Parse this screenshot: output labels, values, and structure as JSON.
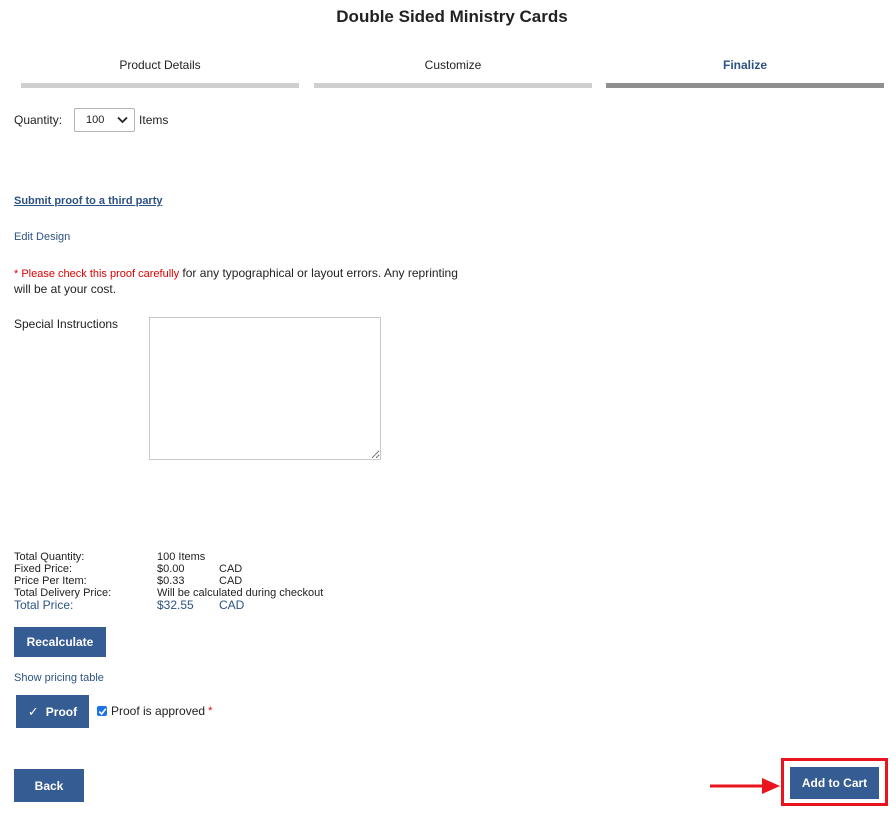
{
  "page": {
    "title": "Double Sided Ministry Cards"
  },
  "steps": [
    {
      "label": "Product Details"
    },
    {
      "label": "Customize"
    },
    {
      "label": "Finalize"
    }
  ],
  "quantity": {
    "label": "Quantity:",
    "selected": "100",
    "unit": "Items"
  },
  "links": {
    "submit_proof": "Submit proof to a third party",
    "edit_design": "Edit Design",
    "show_pricing": "Show pricing table"
  },
  "warning": {
    "highlight": "* Please check this proof carefully",
    "text": " for any typographical or layout errors. Any reprinting will be at your cost."
  },
  "special_instructions": {
    "label": "Special Instructions",
    "value": ""
  },
  "totals": {
    "total_quantity_label": "Total Quantity:",
    "total_quantity_value": "100 Items",
    "fixed_price_label": "Fixed Price:",
    "fixed_price_value": "$0.00",
    "fixed_price_currency": "CAD",
    "price_per_item_label": "Price Per Item:",
    "price_per_item_value": "$0.33",
    "price_per_item_currency": "CAD",
    "delivery_label": "Total Delivery Price:",
    "delivery_value": "Will be calculated during checkout",
    "total_price_label": "Total Price:",
    "total_price_value": "$32.55",
    "total_price_currency": "CAD"
  },
  "buttons": {
    "recalculate": "Recalculate",
    "proof": "Proof",
    "back": "Back",
    "add_to_cart": "Add to Cart"
  },
  "proof_approval": {
    "label": "Proof is approved",
    "required_mark": "*",
    "checked": true
  },
  "icons": {
    "select_chevron": "chevron-down-icon",
    "proof_check": "check-icon",
    "approve_checkbox": "checkbox-checked-icon",
    "annotation_arrow": "arrow-right-icon"
  },
  "colors": {
    "primary_button": "#365d93",
    "link": "#2c5282",
    "warning_red": "#e00000",
    "highlight_red": "#e8141e",
    "step_inactive": "#cfcfcf",
    "step_active": "#8f8f8f"
  }
}
